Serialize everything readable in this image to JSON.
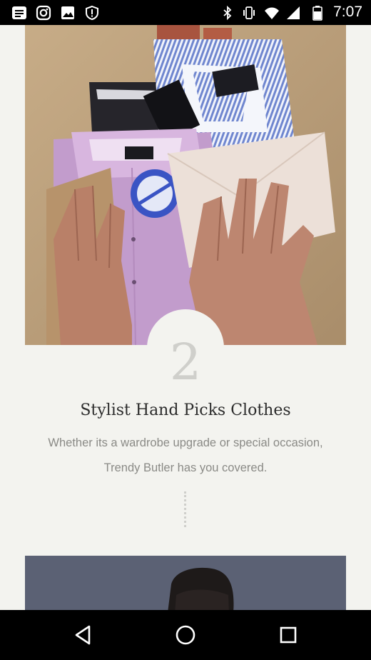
{
  "status_bar": {
    "time": "7:07",
    "left_icons": [
      "notification-list-icon",
      "instagram-icon",
      "image-icon",
      "shield-icon"
    ],
    "right_icons": [
      "bluetooth-icon",
      "vibrate-icon",
      "wifi-icon",
      "signal-icon",
      "battery-icon"
    ]
  },
  "step": {
    "number": "2",
    "title": "Stylist Hand Picks Clothes",
    "description_line1": "Whether its a wardrobe upgrade or special occasion,",
    "description_line2": "Trendy Butler has you covered."
  },
  "colors": {
    "background": "#f3f3ef",
    "title": "#2b2b2b",
    "body_text": "#8a8a86",
    "step_number": "#cfcfcb"
  },
  "nav_bar": {
    "buttons": [
      "back-icon",
      "home-icon",
      "recents-icon"
    ]
  }
}
